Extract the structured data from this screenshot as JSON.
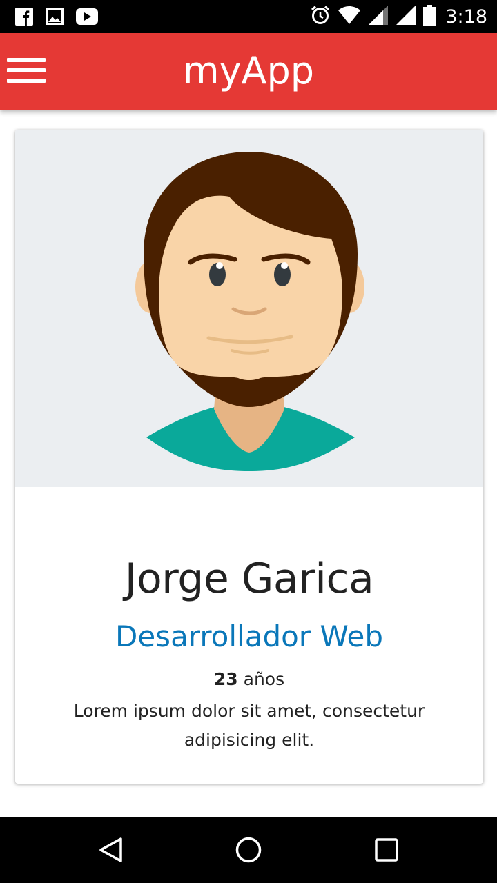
{
  "status_bar": {
    "time": "3:18",
    "left_icons": [
      "facebook-icon",
      "gallery-icon",
      "youtube-icon"
    ],
    "right_icons": [
      "alarm-icon",
      "wifi-icon",
      "signal-icon",
      "signal-icon",
      "battery-icon"
    ]
  },
  "app_bar": {
    "title": "myApp",
    "color": "#e53935",
    "menu_icon": "hamburger-menu-icon"
  },
  "profile": {
    "avatar": "bearded-man-avatar",
    "name": "Jorge Garica",
    "role": "Desarrollador Web",
    "age_value": "23",
    "age_unit": "años",
    "description": "Lorem ipsum dolor sit amet, consectetur adipisicing elit.",
    "role_color": "#0a77b9"
  },
  "nav_bar": {
    "buttons": [
      "back-icon",
      "home-icon",
      "recent-apps-icon"
    ]
  }
}
